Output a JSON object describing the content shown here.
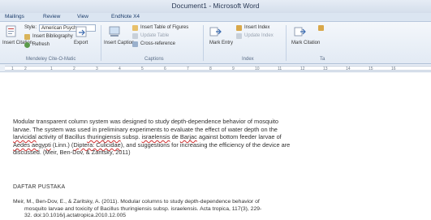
{
  "window": {
    "title": "Document1 - Microsoft Word"
  },
  "tabs": [
    "Mailings",
    "Review",
    "View",
    "EndNote X4"
  ],
  "ribbon": {
    "style_label": "Style:",
    "style_value": "American Psych...",
    "insert_citation": "Insert Citation",
    "insert_bibliography": "Insert Bibliography",
    "refresh": "Refresh",
    "export": "Export",
    "mendeley_group": "Mendeley Cite-O-Matic",
    "insert_caption": "Insert Caption",
    "insert_table_of_figures": "Insert Table of Figures",
    "update_table": "Update Table",
    "cross_reference": "Cross-reference",
    "captions_group": "Captions",
    "mark_entry": "Mark Entry",
    "insert_index": "Insert Index",
    "update_index": "Update Index",
    "index_group": "Index",
    "mark_citation": "Mark Citation",
    "table_group_partial": "Ta"
  },
  "ruler": {
    "numbers": [
      "1",
      "2",
      "1",
      "2",
      "3",
      "4",
      "5",
      "6",
      "7",
      "8",
      "9",
      "10",
      "11",
      "12",
      "13",
      "14",
      "15",
      "16"
    ]
  },
  "document": {
    "p1": "Modular transparent column system was designed to study depth-dependence behavior of mosquito",
    "p2": "larvae. The system was used in preliminary experiments to evaluate the effect of water depth on the",
    "p3a": "larvicidal",
    "p3b": " activity of Bacillus ",
    "p3c": "thuringiensis",
    "p3d": " subsp. ",
    "p3e": "israelensis",
    "p3f": " de ",
    "p3g": "Barjac",
    "p3h": " against bottom feeder larvae of",
    "p4a": "Aedes aegypti",
    "p4b": " (Linn.) (",
    "p4c": "Diptera: Culicidae",
    "p4d": "), and suggestions for increasing the efficiency of the device are",
    "p5": "discussed. (Meir, Ben-Dov, & Zaritsky, 2011)",
    "heading": "DAFTAR PUSTAKA",
    "ref1": "Meir, M., Ben-Dov, E., & Zaritsky, A. (2011). Modular columns to study depth-dependence behavior of",
    "ref2": "mosquito larvae and toxicity of Bacillus thuringiensis subsp. israelensis. Acta tropica, 117(3), 229-",
    "ref3": "32. doi:10.1016/j.actatropica.2010.12.005"
  }
}
